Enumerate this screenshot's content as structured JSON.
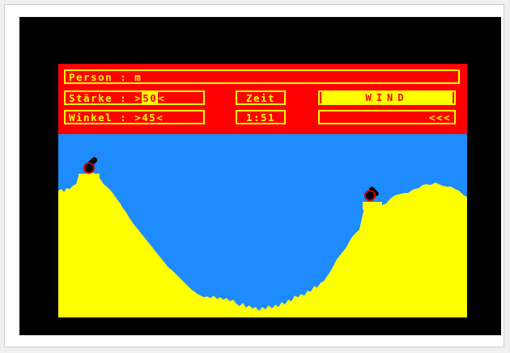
{
  "hud": {
    "person_label": "Person",
    "person_value": "m",
    "strength_label": "Stärke",
    "strength_value": "50",
    "angle_label": "Winkel",
    "angle_value": "45",
    "time_label": "Zeit",
    "time_value": "1:51",
    "wind_label": "WIND",
    "wind_indicator": "<<<"
  },
  "colors": {
    "hud_bg": "#ff0000",
    "hud_text": "#ffff00",
    "sky": "#1e8bff",
    "terrain": "#ffff00",
    "cannon": "#000000",
    "cannon_ring": "#ff0000",
    "border": "#000000"
  },
  "icons": [
    "cannon-left-icon",
    "cannon-right-icon"
  ]
}
